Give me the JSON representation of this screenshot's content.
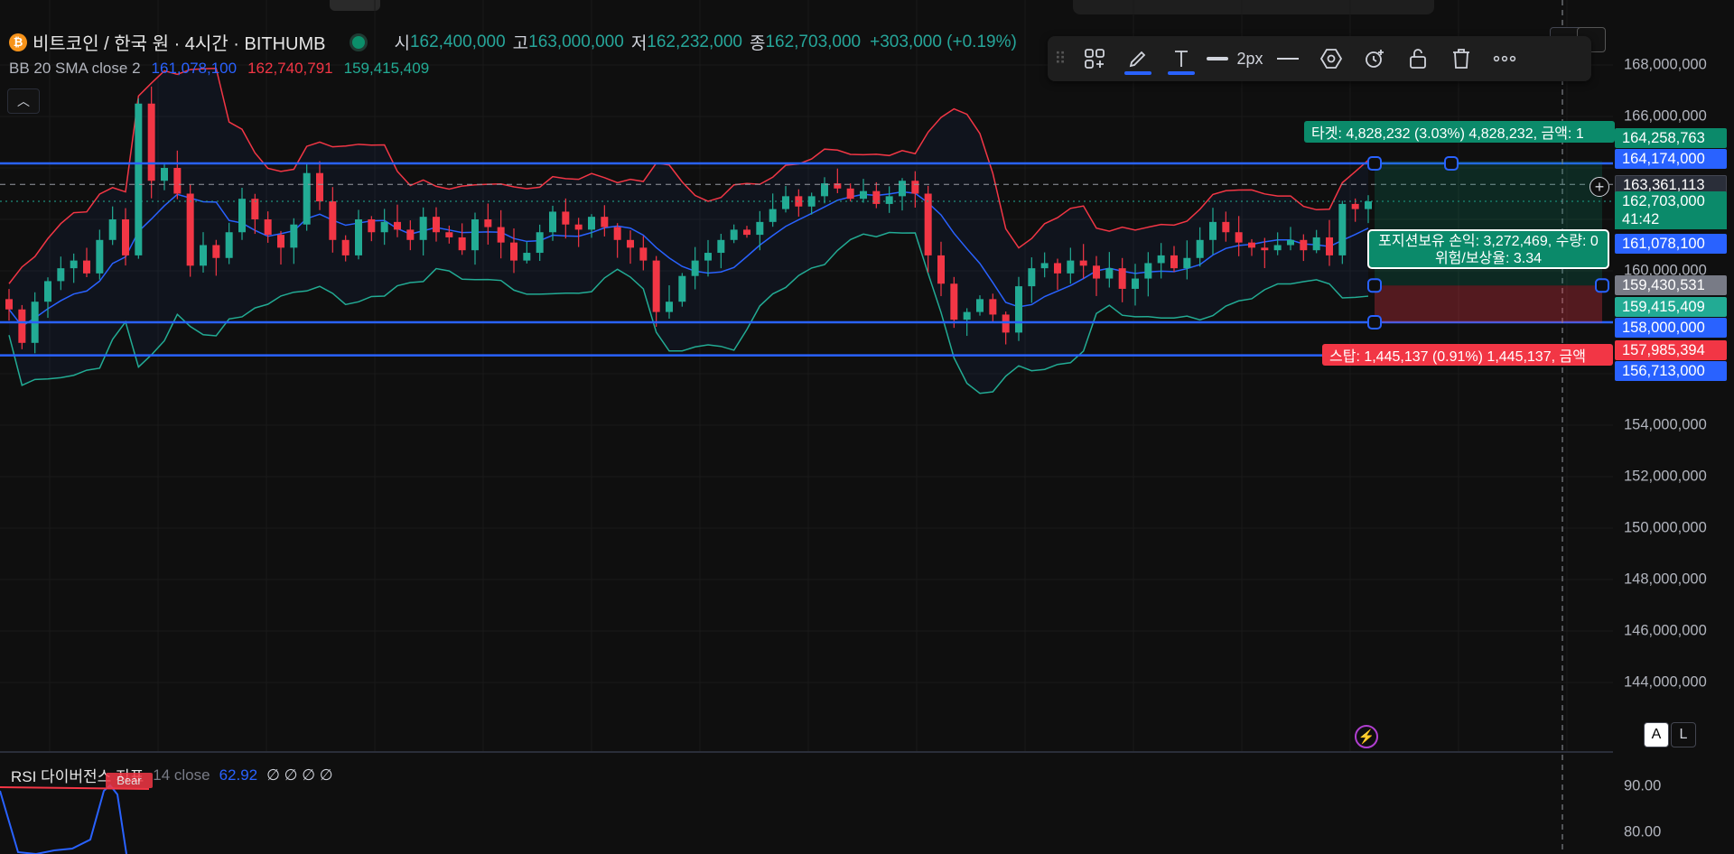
{
  "symbol": {
    "title": "비트코인 / 한국 원 · 4시간 · BITHUMB",
    "coin_icon": "bitcoin-icon"
  },
  "ohlc": {
    "open_label": "시",
    "open": "162,400,000",
    "high_label": "고",
    "high": "163,000,000",
    "low_label": "저",
    "low": "162,232,000",
    "close_label": "종",
    "close": "162,703,000",
    "change": "+303,000 (+0.19%)"
  },
  "bb": {
    "name": "BB 20 SMA close 2",
    "middle": "161,078,100",
    "upper": "162,740,791",
    "lower": "159,415,409"
  },
  "toolbar": {
    "width_label": "2px",
    "items": [
      "grip-icon",
      "templates-icon",
      "pencil-icon",
      "text-icon",
      "line-width",
      "line-style-icon",
      "settings-hexagon-icon",
      "alert-add-icon",
      "unlock-icon",
      "trash-icon",
      "more-icon"
    ]
  },
  "price_axis": {
    "ticks": [
      "168,000,000",
      "166,000,000",
      "160,000,000",
      "154,000,000",
      "152,000,000",
      "150,000,000",
      "148,000,000",
      "146,000,000",
      "144,000,000"
    ],
    "tags": {
      "target_price": "164,258,763",
      "entry_high": "164,174,000",
      "crosshair": "163,361,113",
      "last": "162,703,000",
      "countdown": "41:42",
      "bb_mid": "161,078,100",
      "entry": "159,430,531",
      "bb_low": "159,415,409",
      "range_low": "158,000,000",
      "stop_price": "157,985,394",
      "floor": "156,713,000"
    },
    "rsi_ticks": [
      "90.00",
      "80.00"
    ]
  },
  "position": {
    "target_banner": "타겟: 4,828,232 (3.03%) 4,828,232, 금액: 1",
    "stop_banner": "스탑: 1,445,137 (0.91%) 1,445,137, 금액",
    "pnl_line": "포지션보유 손익: 3,272,469, 수량: 0",
    "rr_line": "위험/보상율: 3.34"
  },
  "scale_buttons": {
    "auto": "A",
    "log": "L"
  },
  "rsi": {
    "name": "RSI 다이버전스 지표",
    "param": "14 close",
    "value": "62.92",
    "na": "∅ ∅ ∅ ∅",
    "bear_label": "Bear"
  },
  "colors": {
    "up": "#22ab94",
    "down": "#f23645",
    "bb_mid": "#2962ff",
    "bb_upper": "#f23645",
    "bb_lower": "#22ab94",
    "hline": "#2962ff",
    "target_zone": "#0b8a6a",
    "stop_zone": "#f23645"
  },
  "chart_data": {
    "type": "candlestick",
    "symbol": "BTC/KRW",
    "timeframe": "4h",
    "ylim": [
      142000000,
      170000000
    ],
    "horizontal_lines": [
      164174000,
      158000000,
      156713000
    ],
    "position": {
      "entry": 159430531,
      "target": 164258763,
      "stop": 157985394
    },
    "close_series": [
      158.5,
      157.2,
      158.8,
      159.6,
      160.1,
      160.4,
      159.9,
      161.2,
      162.0,
      160.6,
      166.5,
      163.5,
      164.0,
      163.0,
      160.2,
      161.0,
      160.5,
      161.5,
      162.8,
      162.0,
      161.4,
      160.9,
      161.8,
      163.8,
      162.7,
      161.2,
      160.6,
      162.0,
      161.5,
      161.9,
      161.6,
      161.2,
      162.1,
      161.5,
      161.3,
      160.8,
      162.0,
      161.7,
      161.1,
      160.4,
      160.7,
      161.5,
      162.3,
      161.8,
      161.6,
      162.1,
      161.7,
      161.2,
      160.9,
      160.4,
      158.4,
      158.8,
      159.8,
      160.4,
      160.7,
      161.2,
      161.6,
      161.4,
      161.9,
      162.4,
      162.9,
      162.5,
      162.9,
      163.4,
      163.2,
      162.8,
      163.1,
      162.6,
      162.9,
      163.5,
      163.0,
      160.6,
      159.5,
      158.1,
      158.4,
      158.9,
      158.3,
      157.6,
      159.4,
      160.1,
      160.3,
      159.9,
      160.4,
      160.2,
      159.7,
      160.1,
      159.3,
      159.7,
      160.3,
      160.6,
      160.1,
      160.5,
      161.2,
      161.9,
      161.5,
      161.1,
      160.9,
      160.8,
      161.0,
      161.2,
      160.8,
      161.3,
      160.6,
      162.6,
      162.4,
      162.7
    ],
    "rsi_last": 62.92
  }
}
